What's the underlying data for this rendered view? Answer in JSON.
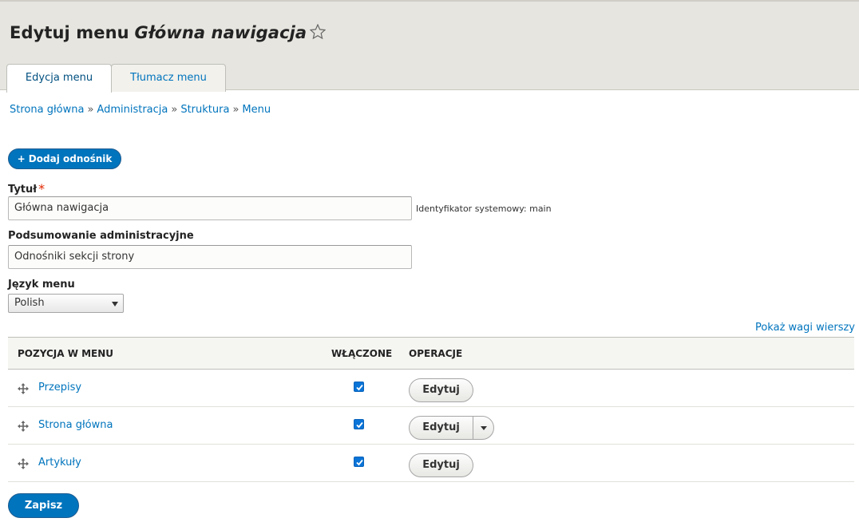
{
  "header": {
    "title_prefix": "Edytuj menu",
    "title_menu_name": "Główna nawigacja",
    "star_icon": "star-outline-icon"
  },
  "tabs": [
    {
      "label": "Edycja menu",
      "active": true
    },
    {
      "label": "Tłumacz menu",
      "active": false
    }
  ],
  "breadcrumb": {
    "items": [
      "Strona główna",
      "Administracja",
      "Struktura",
      "Menu"
    ],
    "separator": "»"
  },
  "add_link_button": {
    "label": "+ Dodaj odnośnik"
  },
  "form": {
    "title_label": "Tytuł",
    "title_required": "*",
    "title_value": "Główna nawigacja",
    "machine_name": "Identyfikator systemowy: main",
    "summary_label": "Podsumowanie administracyjne",
    "summary_value": "Odnośniki sekcji strony",
    "language_label": "Język menu",
    "language_value": "Polish"
  },
  "show_weights_link": "Pokaż wagi wierszy",
  "table": {
    "headers": [
      "POZYCJA W MENU",
      "WŁĄCZONE",
      "OPERACJE"
    ],
    "rows": [
      {
        "title": "Przepisy",
        "enabled": true,
        "operation": "Edytuj",
        "has_dropdown": false
      },
      {
        "title": "Strona główna",
        "enabled": true,
        "operation": "Edytuj",
        "has_dropdown": true
      },
      {
        "title": "Artykuły",
        "enabled": true,
        "operation": "Edytuj",
        "has_dropdown": false
      }
    ]
  },
  "save_button": {
    "label": "Zapisz"
  },
  "colors": {
    "primary_blue": "#0074bd",
    "header_bg": "#e6e5df",
    "required_red": "#e32700",
    "checkbox_blue": "#0a74d8"
  }
}
